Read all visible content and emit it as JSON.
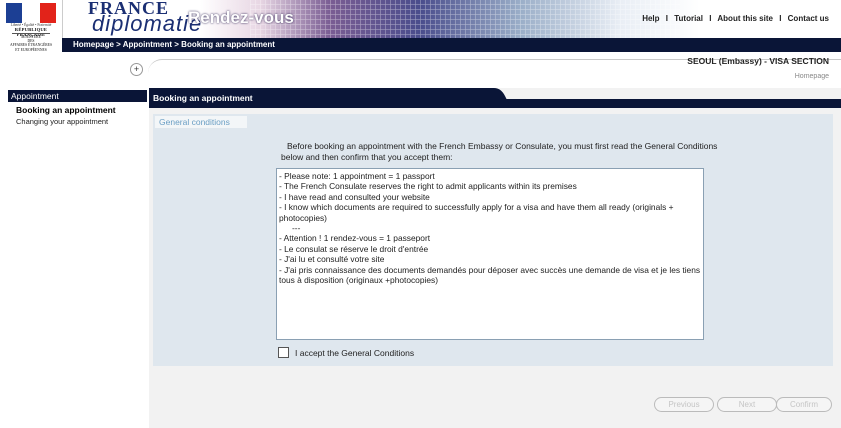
{
  "logo": {
    "motto": "Liberté • Égalité • Fraternité",
    "republic": "RÉPUBLIQUE FRANÇAISE",
    "ministry": [
      "MINISTÈRE",
      "DES",
      "AFFAIRES ÉTRANGÈRES",
      "ET EUROPÉENNES"
    ]
  },
  "brand": {
    "line1": "FRANCE",
    "line2": "diplomatie"
  },
  "app_title": "Rendez-vous",
  "top_links": [
    "Help",
    "Tutorial",
    "About this site",
    "Contact us"
  ],
  "top_links_separator": "I",
  "breadcrumb": "Homepage > Appointment > Booking an appointment",
  "expand_button": "+",
  "section_label": "SEOUL (Embassy) - VISA SECTION",
  "homepage_link": "Homepage",
  "sidebar": {
    "heading": "Appointment",
    "items": [
      "Booking an appointment",
      "Changing your appointment"
    ]
  },
  "main": {
    "tab_title": "Booking an appointment",
    "conditions_tab": "General conditions",
    "intro": "Before booking an appointment with the French Embassy or Consulate, you must first read the General Conditions below and then confirm that you accept them:",
    "terms": [
      "- Please note: 1 appointment = 1 passport",
      "- The French Consulate reserves the right to admit applicants within its premises",
      "- I have read and consulted your website",
      "- I know which documents are required to successfully apply for a visa and have them all ready (originals + photocopies)",
      "---",
      "- Attention ! 1 rendez-vous = 1 passeport",
      "- Le consulat se réserve le droit d'entrée",
      "- J'ai lu et consulté votre site",
      "- J'ai pris connaissance des documents demandés pour déposer avec succès une demande de visa et je les tiens tous à disposition (originaux +photocopies)"
    ],
    "accept_label": "I accept the General Conditions",
    "accept_checked": false
  },
  "buttons": {
    "previous": "Previous",
    "next": "Next",
    "confirm": "Confirm",
    "state": "disabled"
  },
  "colors": {
    "dark_navy": "#0a1537",
    "panel_bg": "#dfe7ee",
    "brand_blue": "#1b2f73",
    "link_blue": "#6a9ec4"
  }
}
